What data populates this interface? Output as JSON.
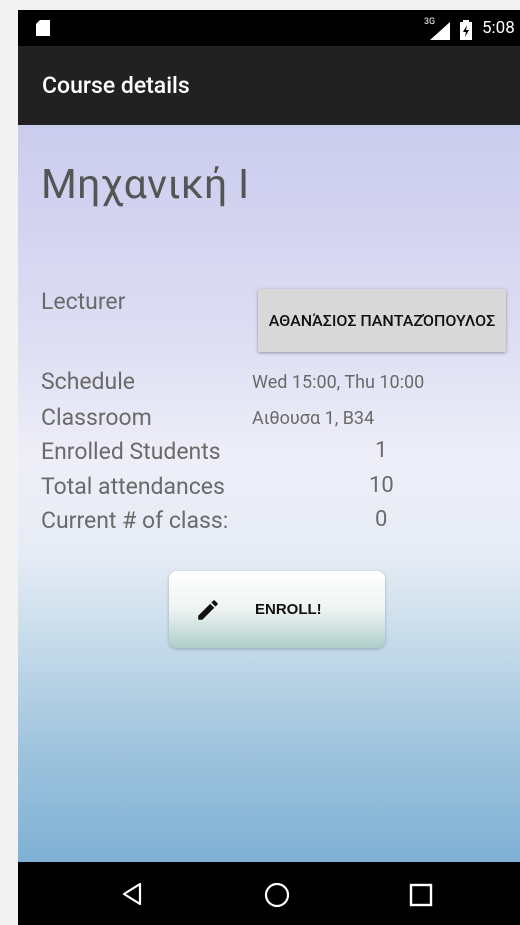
{
  "status_bar": {
    "network": "3G",
    "time": "5:08"
  },
  "app_bar": {
    "title": "Course details"
  },
  "course": {
    "name": "Μηχανική Ι",
    "lecturer_label": "Lecturer",
    "lecturer_name": "ΑΘΑΝΆΣΙΟΣ ΠΑΝΤΑΖΌΠΟΥΛΟΣ",
    "schedule_label": "Schedule",
    "schedule_value": "Wed 15:00, Thu 10:00",
    "classroom_label": "Classroom",
    "classroom_value": "Αιθουσα 1, Β34",
    "enrolled_label": "Enrolled Students",
    "enrolled_value": "1",
    "attendances_label": "Total attendances",
    "attendances_value": "10",
    "current_class_label": "Current # of class:",
    "current_class_value": "0"
  },
  "actions": {
    "enroll_label": "ENROLL!",
    "enroll_icon": "pencil-icon"
  },
  "nav": {
    "back_icon": "back-triangle-icon",
    "home_icon": "home-circle-icon",
    "recents_icon": "recents-square-icon"
  }
}
